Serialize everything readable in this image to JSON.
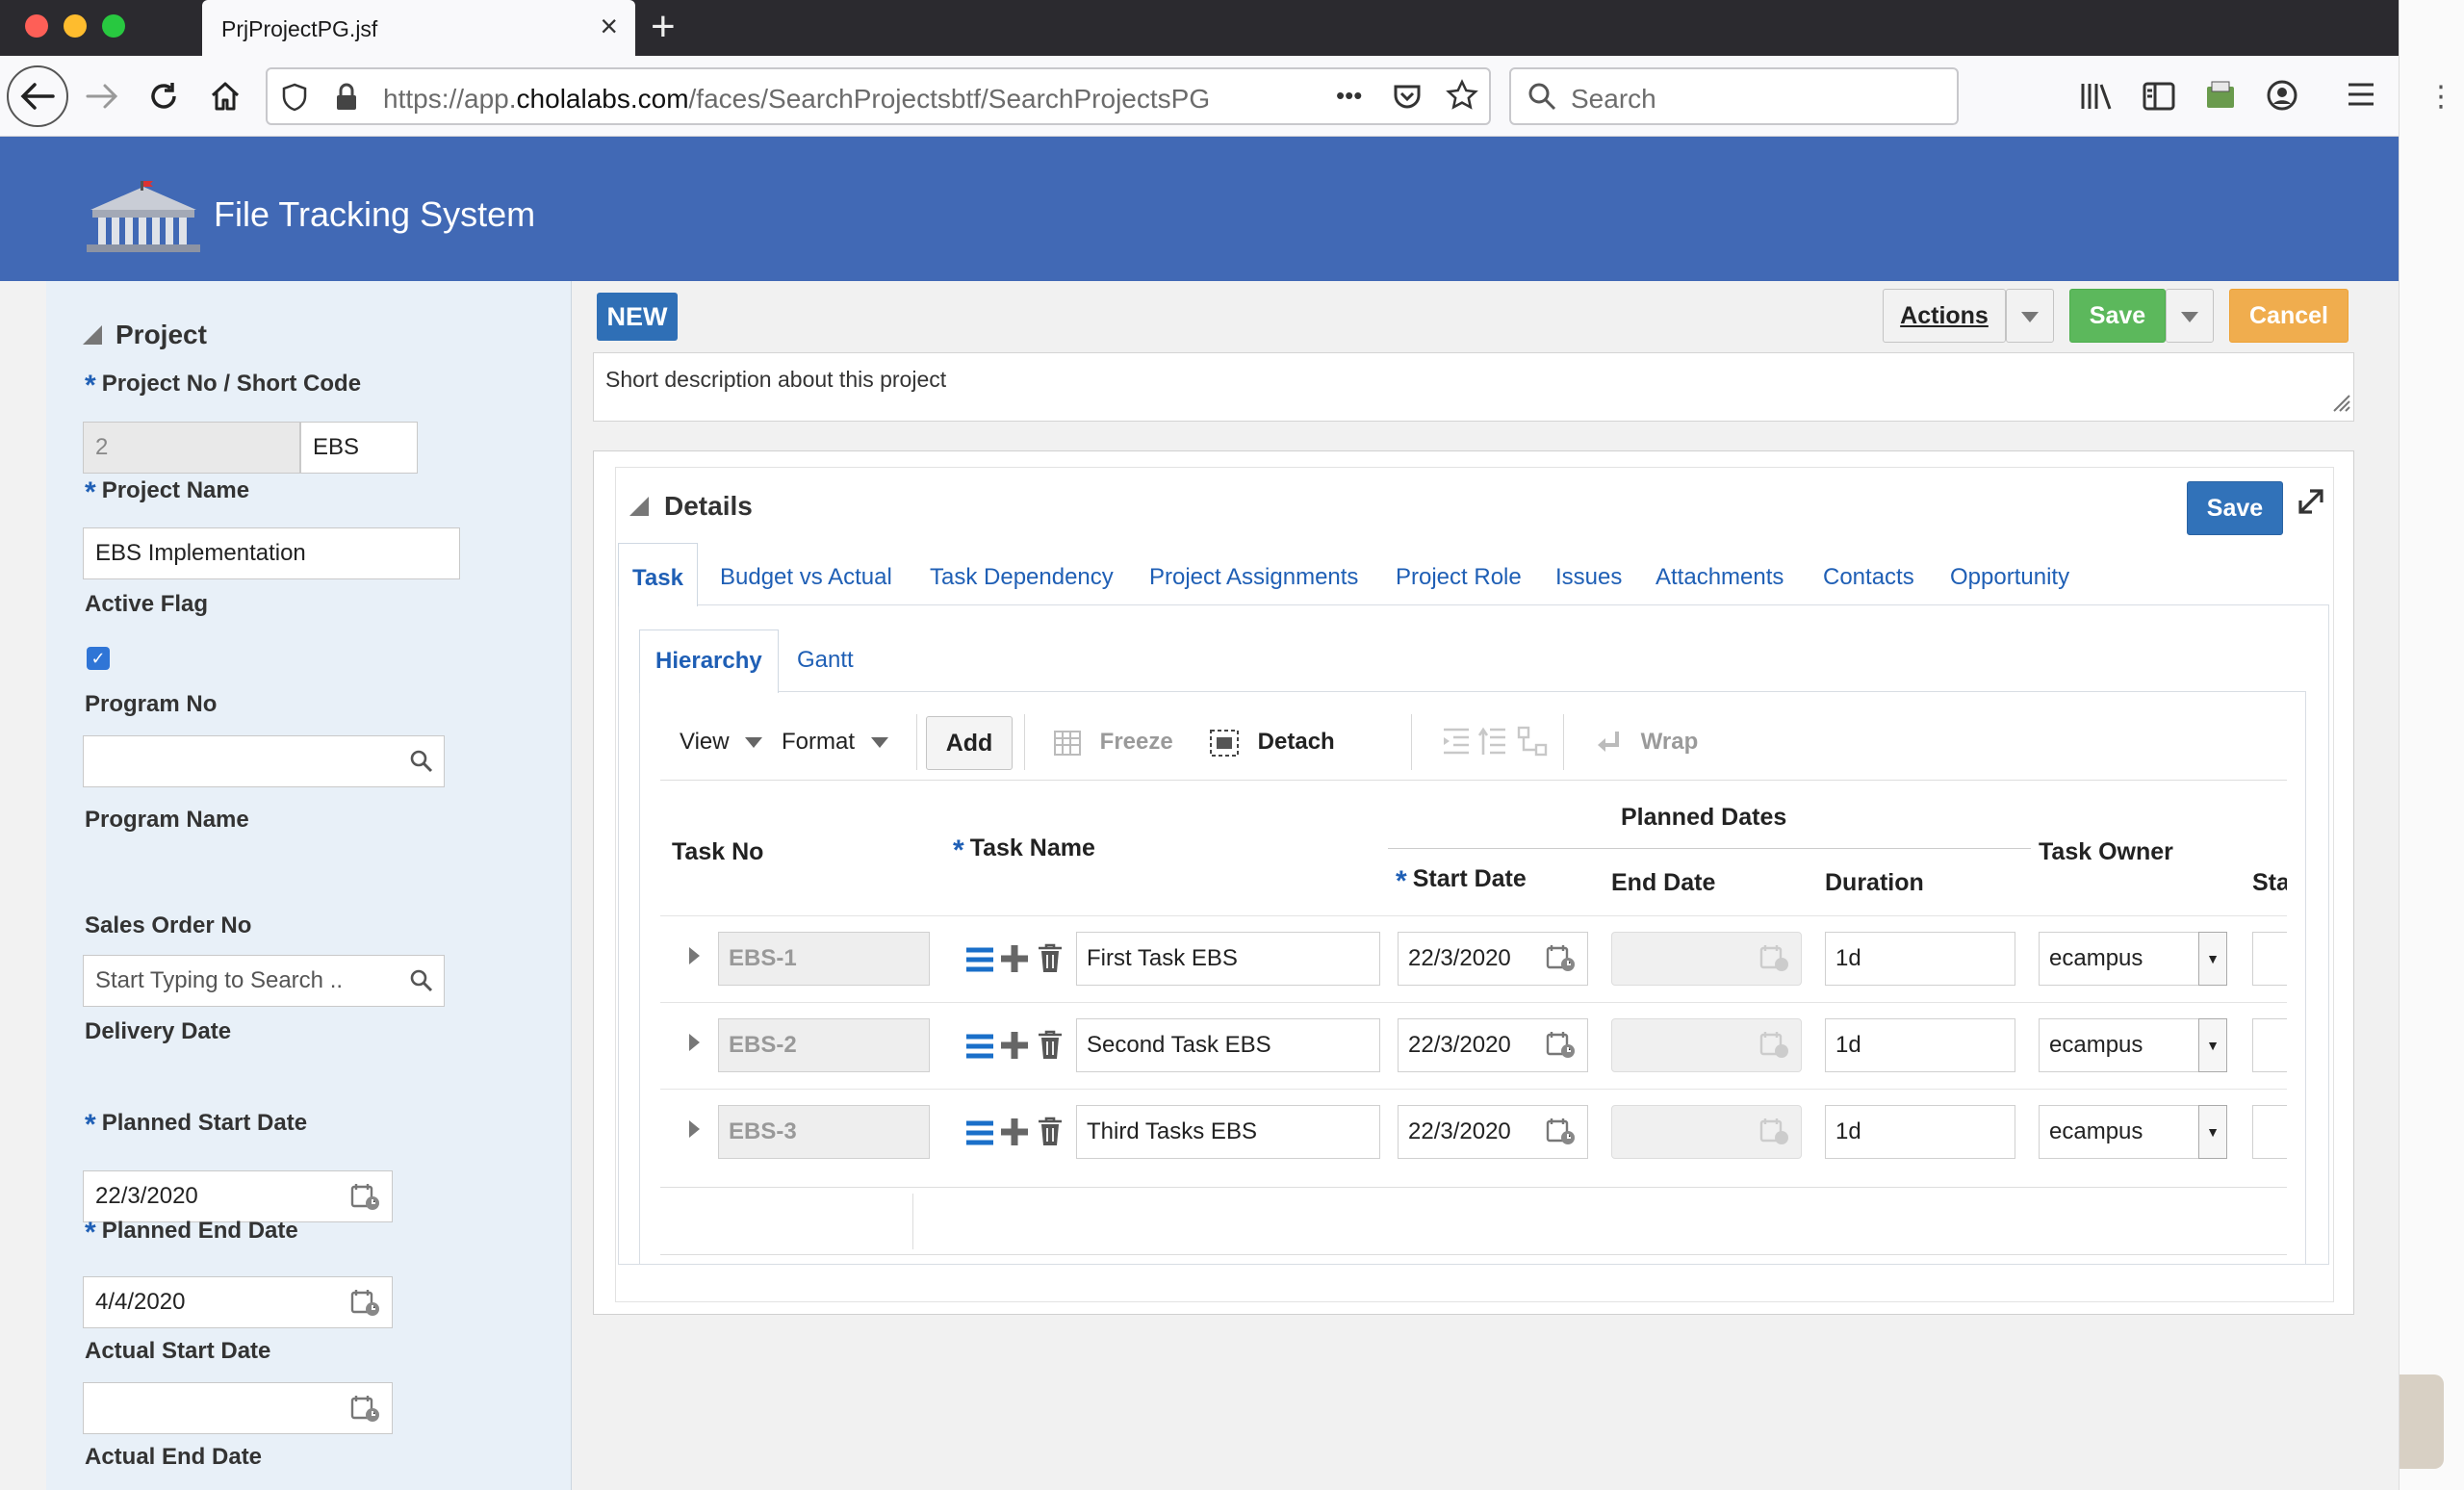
{
  "browser": {
    "tab_title": "PrjProjectPG.jsf",
    "url_prefix": "https://app.",
    "url_domain": "cholalabs.com",
    "url_path": "/faces/SearchProjectsbtf/SearchProjectsPG",
    "search_placeholder": "Search",
    "url_more": "•••"
  },
  "app": {
    "title": "File Tracking System"
  },
  "left": {
    "section_title": "Project",
    "project_no_label": "Project No / Short Code",
    "project_no_value": "2",
    "short_code_value": "EBS",
    "project_name_label": "Project Name",
    "project_name_value": "EBS Implementation",
    "active_flag_label": "Active Flag",
    "program_no_label": "Program No",
    "program_name_label": "Program Name",
    "sales_order_label": "Sales Order No",
    "sales_order_placeholder": "Start Typing to Search ..",
    "delivery_date_label": "Delivery Date",
    "planned_start_label": "Planned Start Date",
    "planned_start_value": "22/3/2020",
    "planned_end_label": "Planned End Date",
    "planned_end_value": "4/4/2020",
    "actual_start_label": "Actual Start Date",
    "actual_end_label": "Actual End Date"
  },
  "main": {
    "status_badge": "NEW",
    "actions_label": "Actions",
    "save_label": "Save",
    "cancel_label": "Cancel",
    "description": "Short description about this project",
    "details_title": "Details",
    "details_save": "Save",
    "tabs": [
      "Task",
      "Budget vs Actual",
      "Task Dependency",
      "Project Assignments",
      "Project Role",
      "Issues",
      "Attachments",
      "Contacts",
      "Opportunity"
    ],
    "subtabs": [
      "Hierarchy",
      "Gantt"
    ],
    "toolbar": {
      "view": "View",
      "format": "Format",
      "add": "Add",
      "freeze": "Freeze",
      "detach": "Detach",
      "wrap": "Wrap"
    },
    "grid": {
      "headers": {
        "task_no": "Task No",
        "task_name": "Task Name",
        "planned_dates": "Planned Dates",
        "start_date": "Start Date",
        "end_date": "End Date",
        "duration": "Duration",
        "task_owner": "Task Owner",
        "status": "Sta"
      },
      "rows": [
        {
          "task_no": "EBS-1",
          "task_name": "First Task EBS",
          "start_date": "22/3/2020",
          "duration": "1d",
          "owner": "ecampus"
        },
        {
          "task_no": "EBS-2",
          "task_name": "Second Task EBS",
          "start_date": "22/3/2020",
          "duration": "1d",
          "owner": "ecampus"
        },
        {
          "task_no": "EBS-3",
          "task_name": "Third Tasks EBS",
          "start_date": "22/3/2020",
          "duration": "1d",
          "owner": "ecampus"
        }
      ]
    }
  },
  "colors": {
    "header_blue": "#4169b5",
    "link_blue": "#1f5fb5",
    "save_green": "#5cb85c",
    "cancel_orange": "#f0ad4e",
    "badge_blue": "#2f6fb6"
  },
  "icons": [
    "back-icon",
    "forward-icon",
    "reload-icon",
    "home-icon",
    "shield-icon",
    "lock-icon",
    "pocket-icon",
    "star-icon",
    "search-icon",
    "library-icon",
    "sidebar-icon",
    "extension-icon",
    "account-icon",
    "hamburger-icon",
    "building-logo-icon",
    "calendar-icon",
    "trash-icon",
    "plus-icon",
    "list-icon",
    "expand-icon"
  ]
}
